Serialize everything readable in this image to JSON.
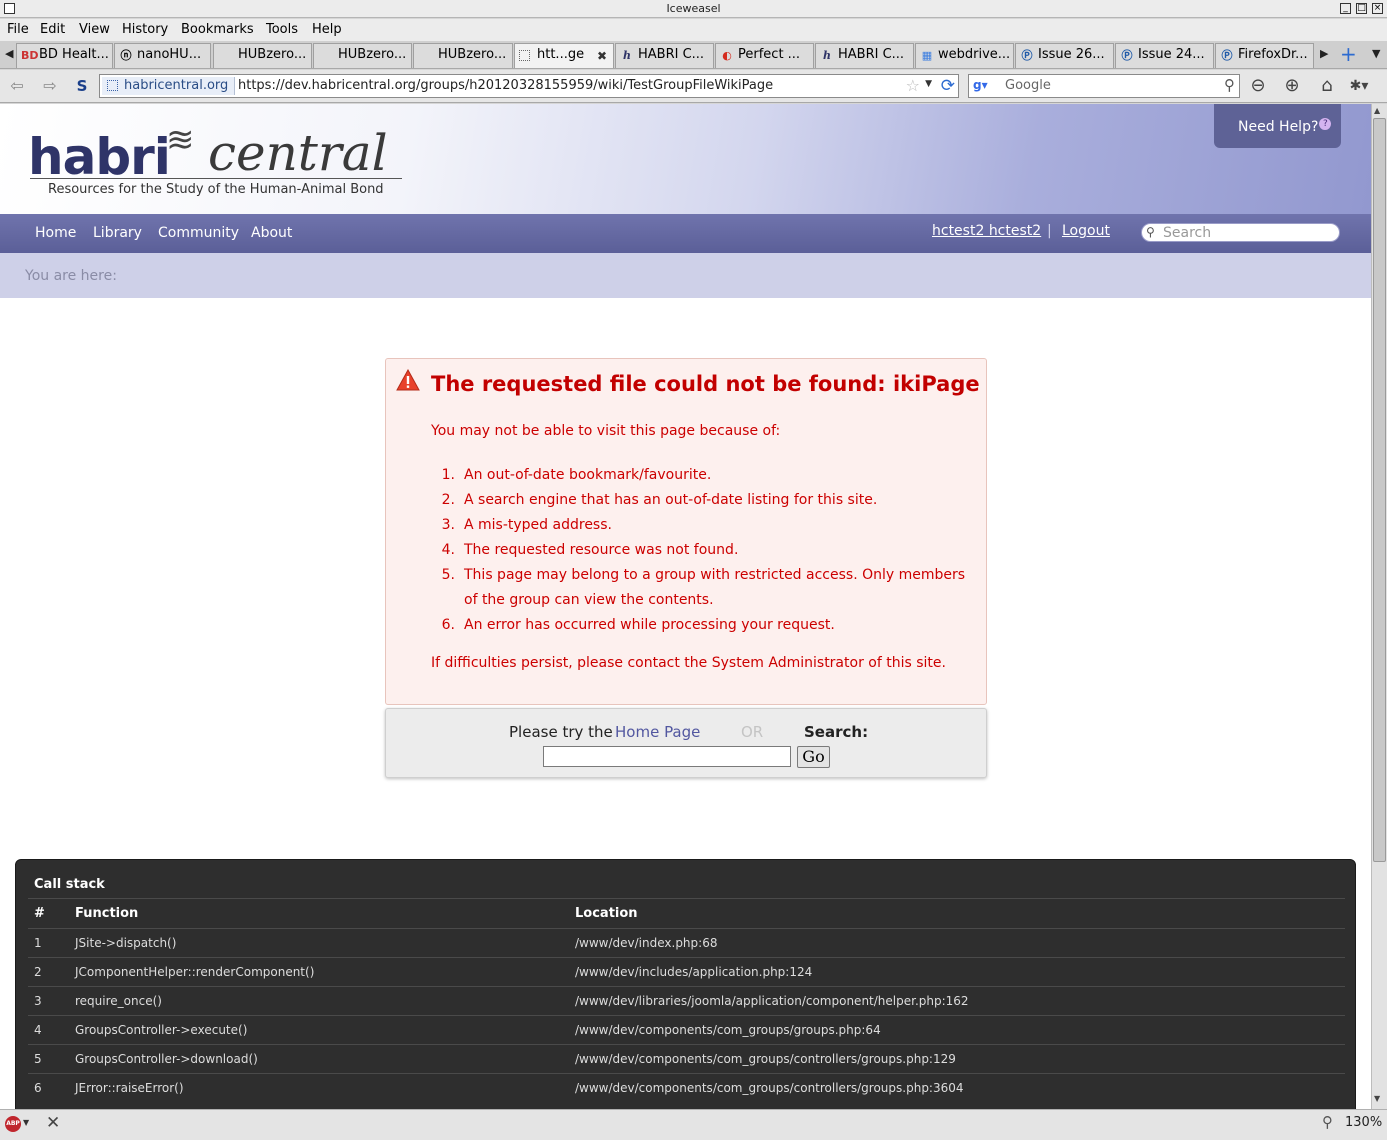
{
  "window": {
    "title": "Iceweasel"
  },
  "menu": [
    "File",
    "Edit",
    "View",
    "History",
    "Bookmarks",
    "Tools",
    "Help"
  ],
  "tabs": [
    {
      "label": "BD Healt...",
      "icon": "bd-icon"
    },
    {
      "label": "nanoHU...",
      "icon": "nanohub-icon"
    },
    {
      "label": "HUBzero...",
      "icon": "blank-icon"
    },
    {
      "label": "HUBzero...",
      "icon": "blank-icon"
    },
    {
      "label": "HUBzero...",
      "icon": "blank-icon"
    },
    {
      "label": "htt...ge",
      "icon": "page-icon",
      "active": true
    },
    {
      "label": "HABRI C...",
      "icon": "habri-icon"
    },
    {
      "label": "Perfect ...",
      "icon": "perfect-icon"
    },
    {
      "label": "HABRI C...",
      "icon": "habri-icon"
    },
    {
      "label": "webdrive...",
      "icon": "google-icon"
    },
    {
      "label": "Issue 26...",
      "icon": "issue-icon"
    },
    {
      "label": "Issue 24...",
      "icon": "issue-icon"
    },
    {
      "label": "FirefoxDr...",
      "icon": "issue-icon"
    }
  ],
  "address": {
    "site": "habricentral.org",
    "url": "https://dev.habricentral.org/groups/h20120328155959/wiki/TestGroupFileWikiPage"
  },
  "web_search": {
    "placeholder": "Google"
  },
  "site": {
    "logo_habri": "habri",
    "logo_central": "central",
    "tagline": "Resources for the Study of the Human-Animal Bond",
    "help_label": "Need Help?",
    "nav": [
      "Home",
      "Library",
      "Community",
      "About"
    ],
    "user": "hctest2 hctest2",
    "separator": "|",
    "logout": "Logout",
    "search_placeholder": "Search",
    "breadcrumb_label": "You are here:"
  },
  "error": {
    "title": "The requested file could not be found: ikiPage",
    "intro": "You may not be able to visit this page because of:",
    "reasons": [
      {
        "num": "1.",
        "text": "An out-of-date bookmark/favourite."
      },
      {
        "num": "2.",
        "text": "A search engine that has an out-of-date listing for this site."
      },
      {
        "num": "3.",
        "text": "A mis-typed address."
      },
      {
        "num": "4.",
        "text": "The requested resource was not found."
      },
      {
        "num": "5.",
        "text": "This page may belong to a group with restricted access. Only members of the group can view the contents."
      },
      {
        "num": "6.",
        "text": "An error has occurred while processing your request."
      }
    ],
    "outro": "If difficulties persist, please contact the System Administrator of this site."
  },
  "try": {
    "prefix": "Please try the",
    "home_link": "Home Page",
    "or": "OR",
    "search_label": "Search:",
    "go": "Go"
  },
  "callstack": {
    "title": "Call stack",
    "headers": [
      "#",
      "Function",
      "Location"
    ],
    "rows": [
      {
        "n": "1",
        "fn": "JSite->dispatch()",
        "loc": "/www/dev/index.php:68"
      },
      {
        "n": "2",
        "fn": "JComponentHelper::renderComponent()",
        "loc": "/www/dev/includes/application.php:124"
      },
      {
        "n": "3",
        "fn": "require_once()",
        "loc": "/www/dev/libraries/joomla/application/component/helper.php:162"
      },
      {
        "n": "4",
        "fn": "GroupsController->execute()",
        "loc": "/www/dev/components/com_groups/groups.php:64"
      },
      {
        "n": "5",
        "fn": "GroupsController->download()",
        "loc": "/www/dev/components/com_groups/controllers/groups.php:129"
      },
      {
        "n": "6",
        "fn": "JError::raiseError()",
        "loc": "/www/dev/components/com_groups/controllers/groups.php:3604"
      }
    ]
  },
  "status": {
    "zoom": "130%",
    "adblock": "ABP"
  },
  "colors": {
    "accent": "#5e6296",
    "error": "#c00000",
    "error_bg": "#fdf0ee"
  }
}
